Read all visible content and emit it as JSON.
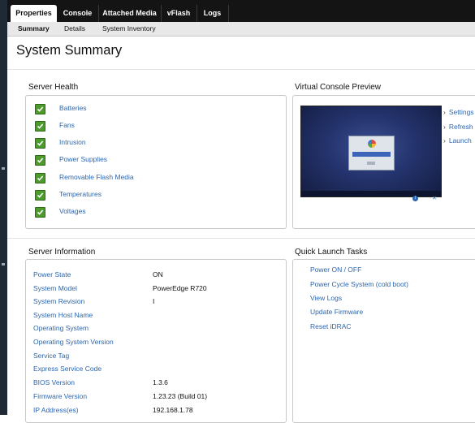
{
  "top_tabs": [
    {
      "label": "Properties",
      "active": true
    },
    {
      "label": "Console",
      "active": false
    },
    {
      "label": "Attached Media",
      "active": false
    },
    {
      "label": "vFlash",
      "active": false
    },
    {
      "label": "Logs",
      "active": false
    }
  ],
  "sub_tabs": [
    {
      "label": "Summary",
      "active": true
    },
    {
      "label": "Details",
      "active": false
    },
    {
      "label": "System Inventory",
      "active": false
    }
  ],
  "page_title": "System Summary",
  "server_health": {
    "title": "Server Health",
    "status_icon": "check-icon",
    "items": [
      "Batteries",
      "Fans",
      "Intrusion",
      "Power Supplies",
      "Removable Flash Media",
      "Temperatures",
      "Voltages"
    ]
  },
  "virtual_console": {
    "title": "Virtual Console Preview",
    "links": [
      "Settings",
      "Refresh",
      "Launch"
    ],
    "info_icon": "info-icon",
    "close_icon": "close-icon"
  },
  "server_information": {
    "title": "Server Information",
    "rows": [
      {
        "label": "Power State",
        "value": "ON"
      },
      {
        "label": "System Model",
        "value": "PowerEdge R720"
      },
      {
        "label": "System Revision",
        "value": "I"
      },
      {
        "label": "System Host Name",
        "value": ""
      },
      {
        "label": "Operating System",
        "value": ""
      },
      {
        "label": "Operating System Version",
        "value": ""
      },
      {
        "label": "Service Tag",
        "value": ""
      },
      {
        "label": "Express Service Code",
        "value": ""
      },
      {
        "label": "BIOS Version",
        "value": "1.3.6"
      },
      {
        "label": "Firmware Version",
        "value": "1.23.23 (Build 01)"
      },
      {
        "label": "IP Address(es)",
        "value": "192.168.1.78"
      }
    ]
  },
  "quick_launch": {
    "title": "Quick Launch Tasks",
    "tasks": [
      "Power ON / OFF",
      "Power Cycle System (cold boot)",
      "View Logs",
      "Update Firmware",
      "Reset iDRAC"
    ]
  },
  "colors": {
    "link": "#2c66b0",
    "status_ok": "#4f9a2d",
    "top_bar": "#141414"
  }
}
